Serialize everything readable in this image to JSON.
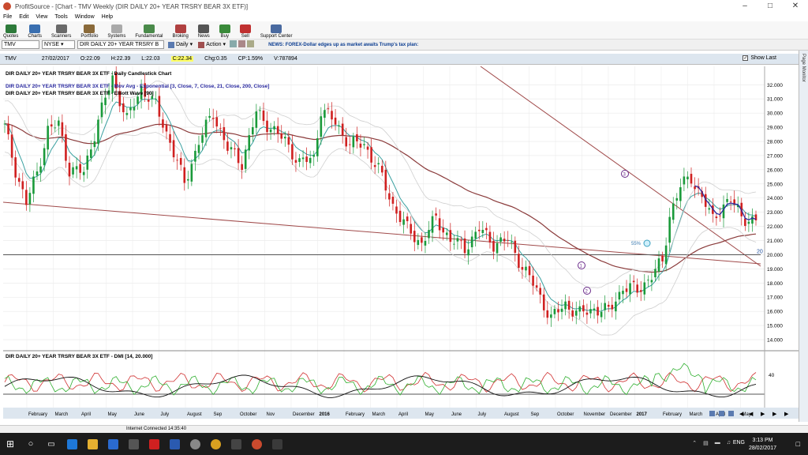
{
  "window": {
    "title": "ProfitSource - [Chart - TMV Weekly (DIR DAILY 20+ YEAR TRSRY BEAR 3X ETF)]"
  },
  "menu": [
    "File",
    "Edit",
    "View",
    "Tools",
    "Window",
    "Help"
  ],
  "toolbar": [
    "Quotes",
    "Charts",
    "Scanners",
    "Portfolio",
    "Systems",
    "Fundamental",
    "Broking",
    "News",
    "Buy",
    "Sell",
    "Support Center"
  ],
  "symbolbar": {
    "symbol": "TMV",
    "exchange": "NYSE",
    "name": "DIR DAILY 20+ YEAR TRSRY B",
    "period": "Daily",
    "action": "Action",
    "news": "NEWS: FOREX-Dollar edges up as market awaits Trump's tax plan:"
  },
  "quote": {
    "symbol": "TMV",
    "date": "27/02/2017",
    "open": "O:22.09",
    "high": "H:22.39",
    "low": "L:22.03",
    "close": "C:22.34",
    "change": "Chg:0.35",
    "pct": "CP:1.59%",
    "volume": "V:787894",
    "show_last": "Show Last"
  },
  "side_panel": "Page Monitor",
  "chart_legend": [
    "DIR DAILY 20+ YEAR TRSRY BEAR 3X ETF - Daily Candlestick Chart",
    "DIR DAILY 20+ YEAR TRSRY BEAR 3X ETF - Mov Avg - Exponential [3, Close, 7, Close, 21, Close, 200, Close]",
    "DIR DAILY 20+ YEAR TRSRY BEAR 3X ETF - Elliott Wave [90]"
  ],
  "dmi_legend": "DIR DAILY 20+ YEAR TRSRY BEAR 3X ETF - DMI [14, 20.000]",
  "chart_data": {
    "type": "candlestick",
    "y_ticks": [
      "32.000",
      "31.000",
      "30.000",
      "29.000",
      "28.000",
      "27.000",
      "26.000",
      "25.000",
      "24.000",
      "23.000",
      "22.000",
      "21.000",
      "20.000",
      "19.000",
      "18.000",
      "17.000",
      "16.000",
      "15.000",
      "14.000"
    ],
    "ylim": [
      13.5,
      33.3
    ],
    "x_labels": [
      "February",
      "March",
      "April",
      "May",
      "June",
      "July",
      "August",
      "Sep",
      "October",
      "Nov",
      "December",
      "2016",
      "February",
      "March",
      "April",
      "May",
      "June",
      "July",
      "August",
      "Sep",
      "October",
      "November",
      "December",
      "2017",
      "February",
      "March",
      "April",
      "May"
    ],
    "hline_value": 20,
    "hline_label": "20",
    "fib_label": "55%",
    "waves": [
      "1",
      "2",
      "3"
    ],
    "dmi_tick": "40",
    "close_path": [
      [
        0,
        29
      ],
      [
        3,
        26
      ],
      [
        6,
        23.6
      ],
      [
        9,
        25.8
      ],
      [
        12,
        28.8
      ],
      [
        15,
        29.2
      ],
      [
        18,
        26
      ],
      [
        22,
        25.8
      ],
      [
        26,
        29.5
      ],
      [
        30,
        32.5
      ],
      [
        34,
        29.5
      ],
      [
        38,
        31.8
      ],
      [
        42,
        30.5
      ],
      [
        46,
        28
      ],
      [
        50,
        25
      ],
      [
        54,
        28
      ],
      [
        58,
        30
      ],
      [
        62,
        27.5
      ],
      [
        66,
        26.5
      ],
      [
        70,
        30
      ],
      [
        74,
        29
      ],
      [
        78,
        28
      ],
      [
        82,
        26.5
      ],
      [
        86,
        26.8
      ],
      [
        88,
        30.3
      ],
      [
        92,
        29.3
      ],
      [
        96,
        27.8
      ],
      [
        100,
        27.8
      ],
      [
        104,
        26
      ],
      [
        108,
        23.5
      ],
      [
        112,
        21.8
      ],
      [
        116,
        20.8
      ],
      [
        120,
        22.6
      ],
      [
        124,
        21
      ],
      [
        128,
        20.5
      ],
      [
        132,
        21.8
      ],
      [
        136,
        20.8
      ],
      [
        140,
        21
      ],
      [
        144,
        19.2
      ],
      [
        148,
        17.5
      ],
      [
        152,
        15.5
      ],
      [
        156,
        16.5
      ],
      [
        160,
        15.8
      ],
      [
        164,
        16.2
      ],
      [
        168,
        16
      ],
      [
        172,
        17.7
      ],
      [
        176,
        17.5
      ],
      [
        180,
        18.5
      ],
      [
        183,
        19.5
      ],
      [
        185,
        22.8
      ],
      [
        188,
        24.8
      ],
      [
        191,
        25.5
      ],
      [
        194,
        24
      ],
      [
        197,
        22.5
      ],
      [
        199,
        23.3
      ],
      [
        202,
        23.8
      ],
      [
        205,
        22.8
      ],
      [
        208,
        22.3
      ]
    ]
  },
  "statusbar": "Internet Connected 14:35:40",
  "clock": {
    "time": "3:13 PM",
    "date": "28/02/2017"
  },
  "lang": "ENG"
}
